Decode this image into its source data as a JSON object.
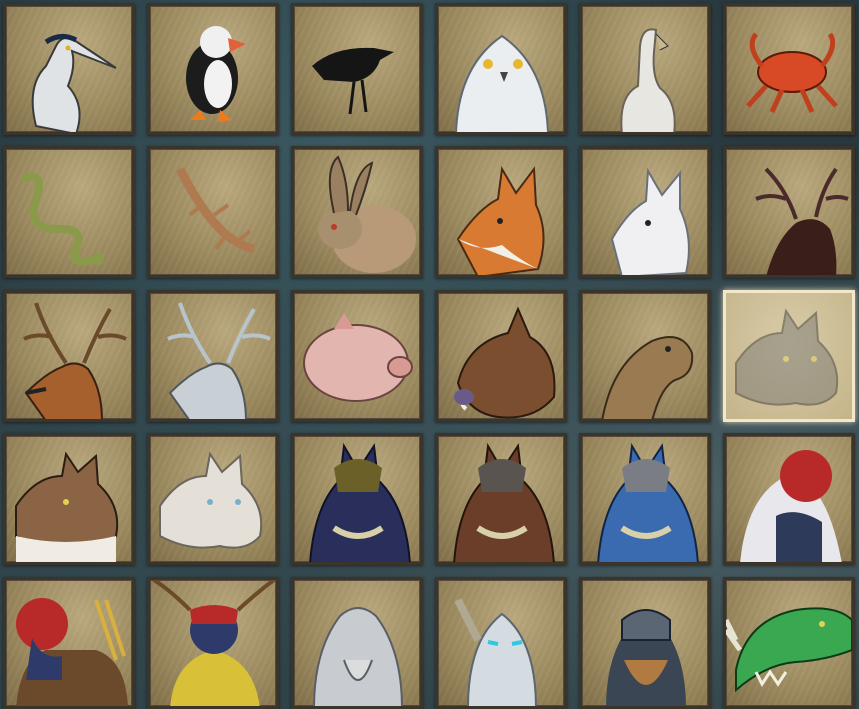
{
  "selected_index": 17,
  "portraits": [
    {
      "id": "heron",
      "icon": "heron-portrait-icon"
    },
    {
      "id": "puffin",
      "icon": "puffin-portrait-icon"
    },
    {
      "id": "crow",
      "icon": "crow-portrait-icon"
    },
    {
      "id": "snowy-owl",
      "icon": "snowy-owl-portrait-icon"
    },
    {
      "id": "vulture",
      "icon": "vulture-portrait-icon"
    },
    {
      "id": "crab",
      "icon": "crab-portrait-icon"
    },
    {
      "id": "snake",
      "icon": "snake-portrait-icon"
    },
    {
      "id": "lizard",
      "icon": "lizard-portrait-icon"
    },
    {
      "id": "hare",
      "icon": "hare-portrait-icon"
    },
    {
      "id": "red-fox",
      "icon": "red-fox-portrait-icon"
    },
    {
      "id": "arctic-fox",
      "icon": "arctic-fox-portrait-icon"
    },
    {
      "id": "dark-elk",
      "icon": "dark-elk-portrait-icon"
    },
    {
      "id": "red-deer",
      "icon": "red-deer-portrait-icon"
    },
    {
      "id": "white-stag",
      "icon": "white-stag-portrait-icon"
    },
    {
      "id": "pig",
      "icon": "pig-portrait-icon"
    },
    {
      "id": "boar",
      "icon": "boar-portrait-icon"
    },
    {
      "id": "seal",
      "icon": "seal-portrait-icon"
    },
    {
      "id": "grey-wolf",
      "icon": "grey-wolf-portrait-icon"
    },
    {
      "id": "brown-wolf",
      "icon": "brown-wolf-portrait-icon"
    },
    {
      "id": "white-wolf",
      "icon": "white-wolf-portrait-icon"
    },
    {
      "id": "dark-werewolf",
      "icon": "dark-werewolf-portrait-icon"
    },
    {
      "id": "brown-werewolf",
      "icon": "brown-werewolf-portrait-icon"
    },
    {
      "id": "blue-werewolf",
      "icon": "blue-werewolf-portrait-icon"
    },
    {
      "id": "white-haired-troll",
      "icon": "white-haired-troll-portrait-icon"
    },
    {
      "id": "masked-troll-archer",
      "icon": "masked-troll-archer-portrait-icon"
    },
    {
      "id": "antlered-troll-shaman",
      "icon": "antlered-troll-shaman-portrait-icon"
    },
    {
      "id": "stone-giant",
      "icon": "stone-giant-portrait-icon"
    },
    {
      "id": "frost-elf",
      "icon": "frost-elf-portrait-icon"
    },
    {
      "id": "bearded-warrior",
      "icon": "bearded-warrior-portrait-icon"
    },
    {
      "id": "green-dragon",
      "icon": "green-dragon-portrait-icon"
    }
  ]
}
